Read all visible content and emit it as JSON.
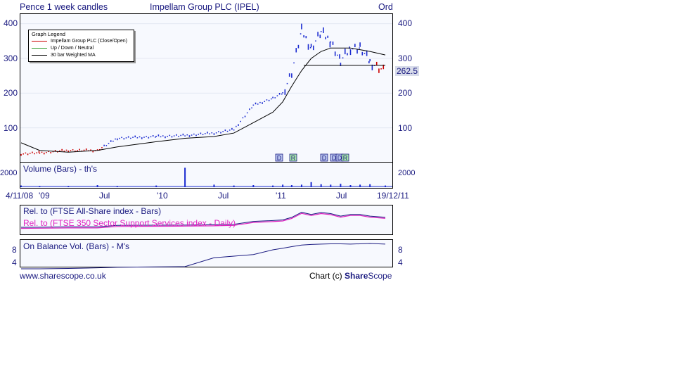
{
  "header": {
    "left": "Pence 1 week candles",
    "title": "Impellam Group PLC (IPEL)",
    "right": "Ord"
  },
  "legend": {
    "title": "Graph Legend",
    "items": [
      {
        "label": "Impellam Group PLC (Close/Open)",
        "color": "#cc0000"
      },
      {
        "label": "Up / Down / Neutral",
        "color": "#2b9a2b"
      },
      {
        "label": "30 bar Weighted MA",
        "color": "#000000"
      }
    ]
  },
  "price_axis": {
    "ticks": [
      "400",
      "300",
      "200",
      "100"
    ],
    "last_price": "262.5"
  },
  "volume_panel": {
    "label": "Volume (Bars) - th's",
    "tick": "2000"
  },
  "relative_panel": {
    "label1": "Rel. to (FTSE All-Share index - Bars)",
    "label2": "Rel. to (FTSE 350 Sector Support Services index - Daily)",
    "color1": "#1a1a80",
    "color2": "#e020c0"
  },
  "obv_panel": {
    "label": "On Balance Vol. (Bars) - M's",
    "ticks": [
      "8",
      "4"
    ]
  },
  "x_axis": {
    "labels": [
      "4/11/08",
      "'09",
      "Jul",
      "'10",
      "Jul",
      "'11",
      "Jul",
      "19/12/11"
    ]
  },
  "events": [
    "D",
    "R",
    "D",
    "D",
    "D",
    "R"
  ],
  "footer": {
    "left": "www.sharescope.co.uk",
    "right_prefix": "Chart (c) ",
    "brand_bold": "Share",
    "brand_rest": "Scope"
  },
  "chart_data": {
    "type": "line",
    "title": "Impellam Group PLC (IPEL)",
    "x": [
      "2008-11-04",
      "2009-01-01",
      "2009-04-01",
      "2009-07-01",
      "2009-09-01",
      "2010-01-01",
      "2010-04-01",
      "2010-07-01",
      "2010-09-01",
      "2010-11-01",
      "2011-01-01",
      "2011-02-01",
      "2011-03-01",
      "2011-04-01",
      "2011-05-01",
      "2011-06-01",
      "2011-07-01",
      "2011-08-01",
      "2011-09-01",
      "2011-10-01",
      "2011-11-01",
      "2011-12-19"
    ],
    "series": [
      {
        "name": "Impellam Group PLC (Close/Open)",
        "values": [
          25,
          28,
          35,
          35,
          70,
          75,
          78,
          85,
          95,
          165,
          185,
          200,
          260,
          380,
          330,
          375,
          350,
          290,
          330,
          330,
          290,
          262.5
        ]
      },
      {
        "name": "30 bar Weighted MA",
        "values": [
          57,
          35,
          30,
          35,
          45,
          60,
          70,
          75,
          85,
          115,
          145,
          175,
          220,
          265,
          300,
          320,
          330,
          330,
          330,
          325,
          320,
          310
        ]
      }
    ],
    "ylim": [
      0,
      420
    ],
    "volume": {
      "label": "Volume (Bars) - th's",
      "values": [
        200,
        150,
        150,
        250,
        150,
        200,
        2300,
        300,
        200,
        250,
        200,
        300,
        250,
        300,
        600,
        350,
        300,
        400,
        250,
        300,
        350,
        200
      ]
    },
    "obv": {
      "label": "On Balance Vol. (Bars) - M's",
      "values": [
        2,
        2,
        2.1,
        2.3,
        2.5,
        2.6,
        2.7,
        5.5,
        6,
        6.5,
        8,
        8.5,
        9,
        9.5,
        9.7,
        9.8,
        9.9,
        9.9,
        9.8,
        9.9,
        10,
        9.8
      ],
      "ylim": [
        1,
        11
      ]
    }
  }
}
